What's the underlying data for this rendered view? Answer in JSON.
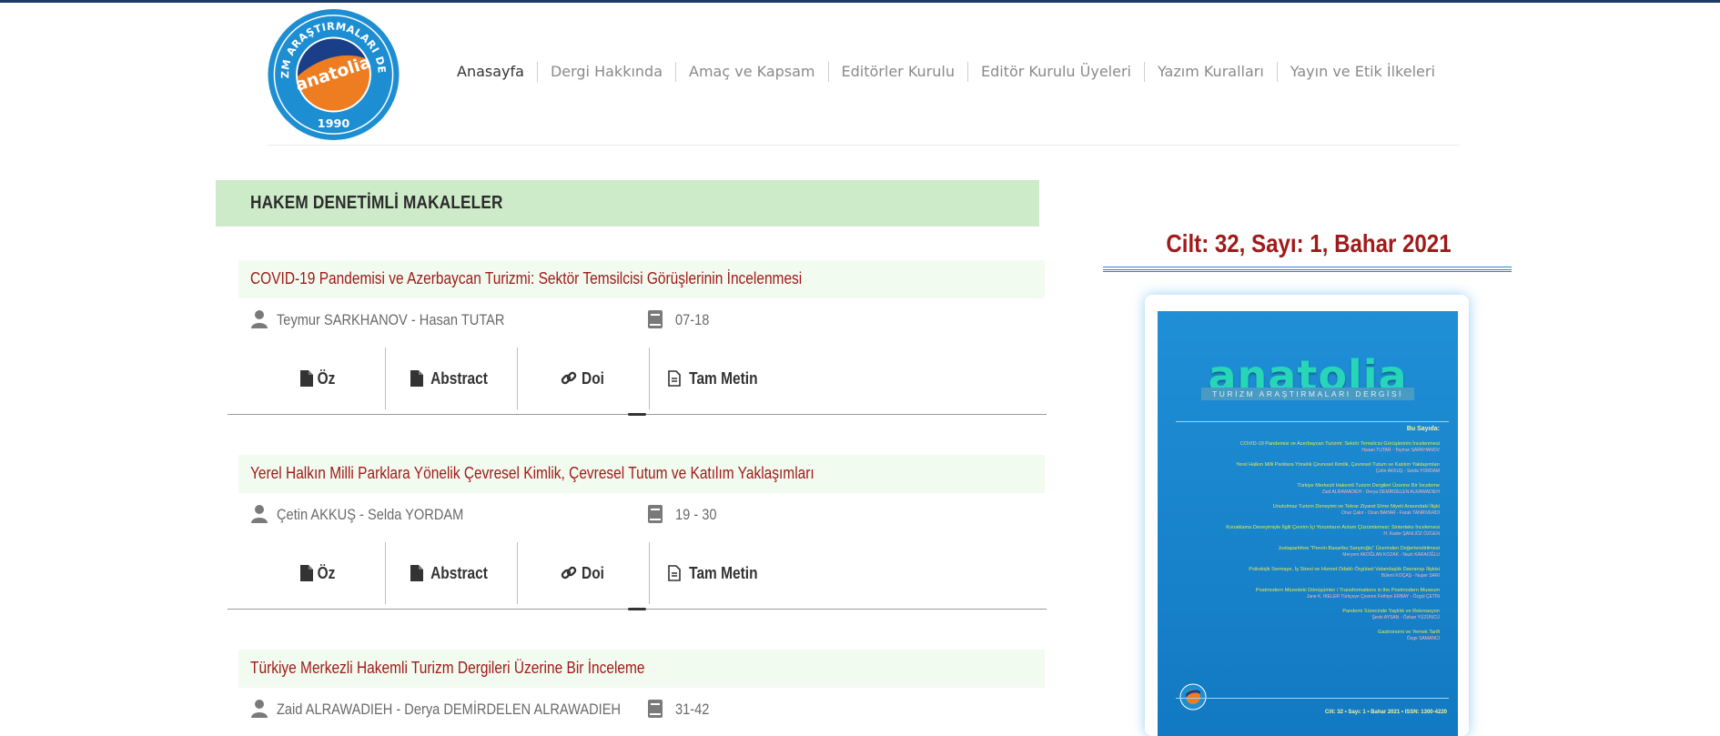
{
  "header": {
    "logo": {
      "ring_text": "TURİZM ARAŞTIRMALARI DERGİSİ",
      "name": "anatolia",
      "year": "1990"
    },
    "nav": [
      {
        "label": "Anasayfa",
        "active": true
      },
      {
        "label": "Dergi Hakkında"
      },
      {
        "label": "Amaç ve Kapsam"
      },
      {
        "label": "Editörler Kurulu"
      },
      {
        "label": "Editör Kurulu Üyeleri"
      },
      {
        "label": "Yazım Kuralları"
      },
      {
        "label": "Yayın ve Etik İlkeleri"
      }
    ]
  },
  "section": {
    "title": "HAKEM DENETİMLİ MAKALELER"
  },
  "articles": [
    {
      "title": "COVID-19 Pandemisi ve Azerbaycan Turizmi: Sektör Temsilcisi Görüşlerinin İncelenmesi",
      "authors": "Teymur SARKHANOV - Hasan TUTAR",
      "pages": "07-18",
      "links": {
        "oz": "Öz",
        "abstract": "Abstract",
        "doi": "Doi",
        "full": "Tam Metin"
      }
    },
    {
      "title": "Yerel Halkın Milli Parklara Yönelik Çevresel Kimlik, Çevresel Tutum ve Katılım Yaklaşımları",
      "authors": "Çetin AKKUŞ - Selda YORDAM",
      "pages": "19 - 30",
      "links": {
        "oz": "Öz",
        "abstract": "Abstract",
        "doi": "Doi",
        "full": "Tam Metin"
      }
    },
    {
      "title": "Türkiye Merkezli Hakemli Turizm Dergileri Üzerine Bir İnceleme",
      "authors": "Zaid ALRAWADIEH - Derya DEMİRDELEN ALRAWADIEH",
      "pages": "31-42"
    }
  ],
  "sidebar": {
    "issue_title": "Cilt: 32, Sayı: 1, Bahar 2021",
    "cover": {
      "brand": "anatolia",
      "subtitle": "TURİZM ARAŞTIRMALARI DERGİSİ",
      "bu_sayida": "Bu Sayıda:",
      "toc": [
        {
          "title": "COVID-19 Pandemisi ve Azerbaycan Turizmi: Sektör Temsilcisi Görüşlerinin İncelenmesi",
          "authors": "Hasan TUTAR - Teymur SARKHANOV"
        },
        {
          "title": "Yerel Halkın Milli Parklara Yönelik Çevresel Kimlik, Çevresel Tutum ve Katılım Yaklaşımları",
          "authors": "Çetin AKKUŞ - Selda YORDAM"
        },
        {
          "title": "Türkiye Merkezli Hakemli Turizm Dergileri Üzerine Bir İnceleme",
          "authors": "Zaid ALRAWADIEH - Derya DEMİRDELEN ALRAWADIEH"
        },
        {
          "title": "Unutulmaz Turizm Deneyimi ve Tekrar Ziyaret Etme Niyeti Arasındaki İlişki",
          "authors": "Onur Çakır - Ozan BAHAR - Faruk TANRIVERDİ"
        },
        {
          "title": "Konaklama Deneyimiyle İlgili Çevrim İçi Yorumların Anlam Çözümlemesi: Sinterteks İncelemesi",
          "authors": "H. Kader ŞANLIÖZ ÖZGEN"
        },
        {
          "title": "Justaparkfore \"Pervin Basaribu Sarşıtoğlu\" Üzerinden Değerlendirilmesi",
          "authors": "Meryem AKOĞLAN KOZAK - Nazlı KARAOĞLU"
        },
        {
          "title": "Psikolojik Sermaye, İş Stresi ve Hizmet Odaklı Örgütsel Vatandaşlık Davranışı İlişkisi",
          "authors": "Bülent KOÇAŞ - Nuper SARI"
        },
        {
          "title": "Postmodern Müzedeki Dönüşümler / Transformations in the Postmodern Museum",
          "authors": "Jane K. İKELER Türkçeye Çeviren Fethiye ERBAY - Özgül ÇETİN"
        },
        {
          "title": "Pandemi Sürecinde Yaşlılık ve Rekreasyon",
          "authors": "Şevki AYSAN - Özkan YÜZÜNCÜ"
        },
        {
          "title": "Gastronomi ve Yemek Tarifi",
          "authors": "Özge SAMANCI"
        }
      ],
      "footer": "Cilt: 32 • Sayı: 1 • Bahar 2021 • ISSN: 1300-4220"
    }
  },
  "colors": {
    "accent_red": "#a01a1a",
    "section_bg": "#cdebc8",
    "title_bar_bg": "#f2fbef",
    "logo_blue": "#1e8ed3",
    "logo_orange": "#ee7d22",
    "cover_blue": "#1279c2"
  }
}
